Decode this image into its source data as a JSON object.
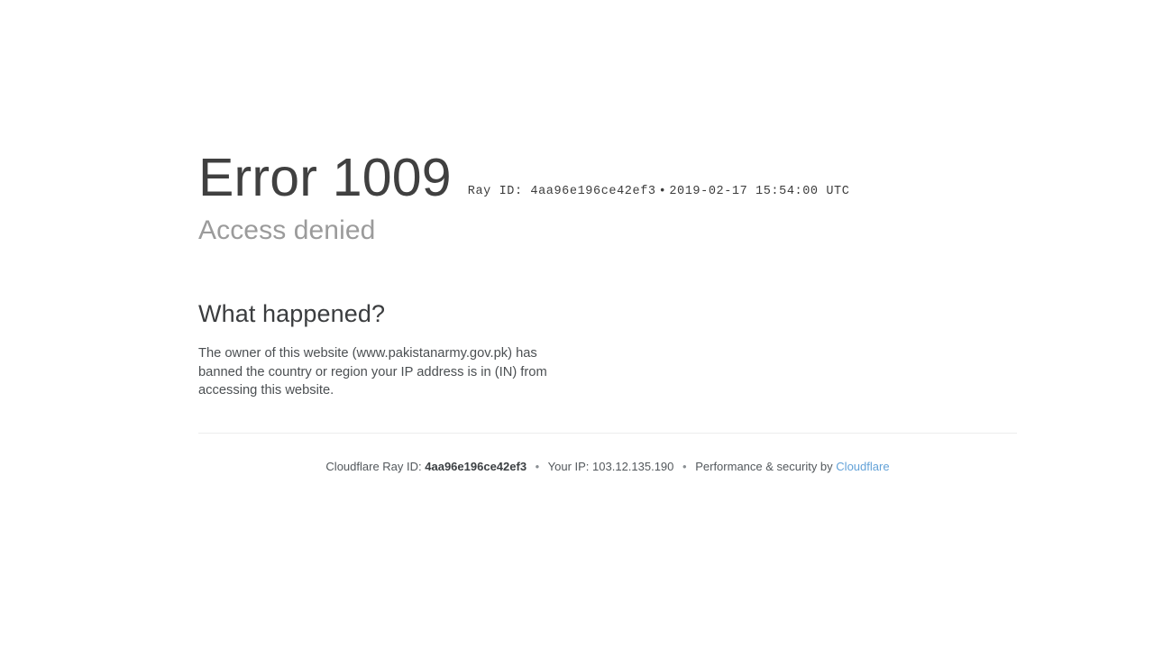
{
  "page": {
    "background_color": "#ffffff",
    "text_color": "#404040"
  },
  "error": {
    "code_label": "Error 1009",
    "subtitle": "Access denied",
    "ray_meta": {
      "ray_id_label": "Ray ID: 4aa96e196ce42ef3",
      "separator": "•",
      "timestamp": "2019-02-17 15:54:00 UTC"
    }
  },
  "what_happened": {
    "heading": "What happened?",
    "body": "The owner of this website (www.pakistanarmy.gov.pk) has banned the country or region your IP address is in (IN) from accessing this website."
  },
  "footer": {
    "ray_id_label": "Cloudflare Ray ID:",
    "ray_id_value": "4aa96e196ce42ef3",
    "separator_1": "•",
    "your_ip_label": "Your IP:",
    "your_ip_value": "103.12.135.190",
    "separator_2": "•",
    "performance_label": "Performance & security by",
    "cloudflare_link": "Cloudflare",
    "link_color": "#63a2d8"
  }
}
